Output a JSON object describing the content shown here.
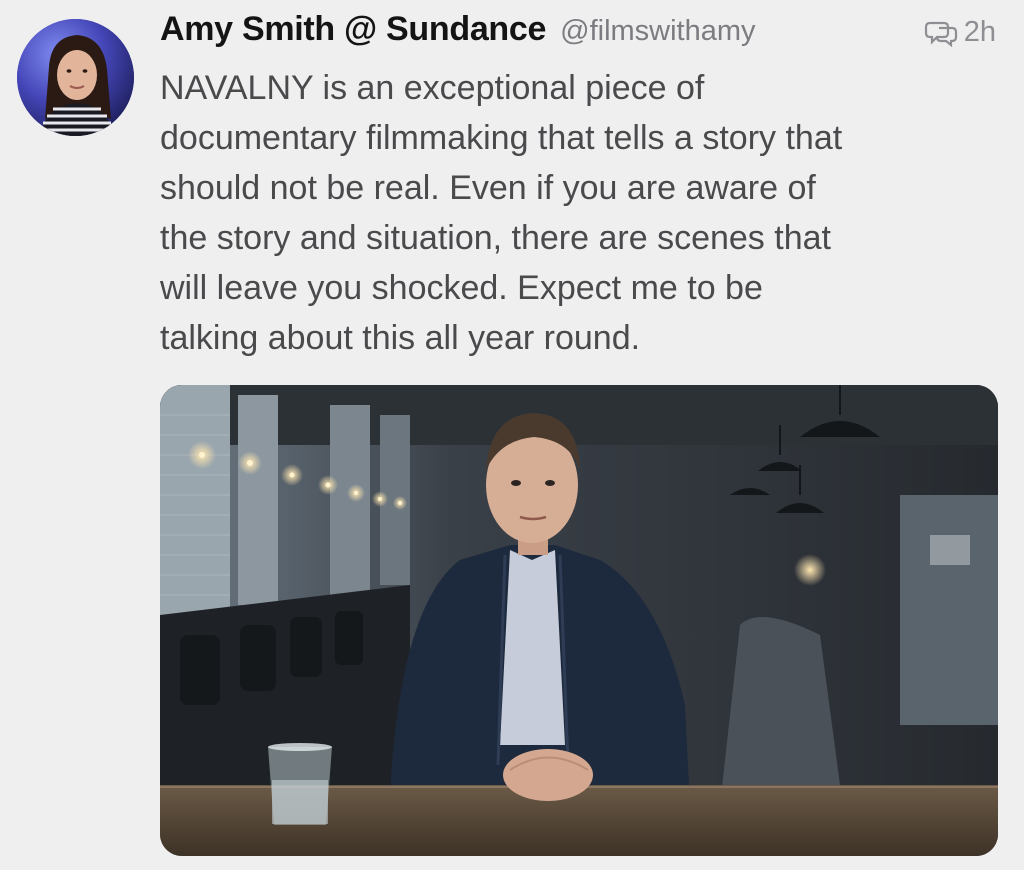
{
  "tweet": {
    "display_name": "Amy Smith @ Sundance",
    "handle": "@filmswithamy",
    "timestamp": "2h",
    "reply_icon": "conversation-bubbles-icon",
    "text": "NAVALNY is an exceptional piece of\ndocumentary filmmaking that tells a story that\nshould not be real. Even if you are aware of\nthe story and situation, there are scenes that\nwill leave you shocked. Expect me to be\ntalking about this all year round.",
    "avatar_icon": "user-avatar-photo",
    "media_icon": "film-still-photo"
  },
  "colors": {
    "background": "#efeff0",
    "name": "#141414",
    "handle": "#7b7b80",
    "body": "#4a4a4d"
  }
}
